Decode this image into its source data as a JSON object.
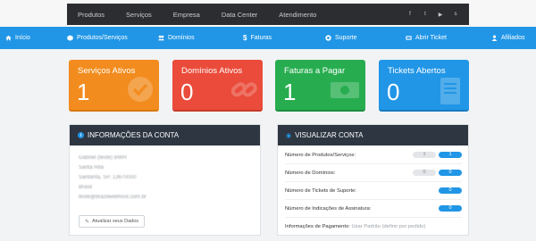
{
  "topnav": {
    "links": [
      "Produtos",
      "Serviços",
      "Empresa",
      "Data Center",
      "Atendimento"
    ],
    "socials": [
      "facebook-icon",
      "twitter-icon",
      "youtube-icon",
      "skype-icon"
    ]
  },
  "mainnav": {
    "items": [
      {
        "label": "Início",
        "icon": "home-icon"
      },
      {
        "label": "Produtos/Serviços",
        "icon": "cube-icon"
      },
      {
        "label": "Domínios",
        "icon": "users-icon"
      },
      {
        "label": "Faturas",
        "icon": "dollar-icon"
      },
      {
        "label": "Suporte",
        "icon": "support-icon"
      },
      {
        "label": "Abrir Ticket",
        "icon": "ticket-icon"
      },
      {
        "label": "Afiliados",
        "icon": "user-icon"
      }
    ]
  },
  "cards": [
    {
      "title": "Serviços Ativos",
      "count": "1",
      "color": "#f28c1e",
      "icon": "check-icon"
    },
    {
      "title": "Domínios Ativos",
      "count": "0",
      "color": "#ea4b3a",
      "icon": "link-icon"
    },
    {
      "title": "Faturas a Pagar",
      "count": "1",
      "color": "#27ad50",
      "icon": "money-icon"
    },
    {
      "title": "Tickets Abertos",
      "count": "0",
      "color": "#2196e6",
      "icon": "document-icon"
    }
  ],
  "account": {
    "heading": "INFORMAÇÕES DA CONTA",
    "lines": [
      "Gabriel (teste) BWH",
      "Santa Rita",
      "Santarita, SP, 13670000",
      "Brasil",
      "teste@brazilwebhost.com.br"
    ],
    "update_label": "Atualizar seus Dados"
  },
  "overview": {
    "heading": "VISUALIZAR CONTA",
    "rows": [
      {
        "label": "Número de Produtos/Serviços:",
        "grey": "1",
        "blue": "1"
      },
      {
        "label": "Número de Domínios:",
        "grey": "0",
        "blue": "0"
      },
      {
        "label": "Número de Tickets de Suporte:",
        "grey": "",
        "blue": "0"
      },
      {
        "label": "Número de Indicações de Assinatura:",
        "grey": "",
        "blue": "0"
      }
    ],
    "payment_label": "Informações de Pagamento:",
    "payment_value": "Usar Padrão (definir por pedido)"
  },
  "colors": {
    "topbar": "#2b2d30",
    "mainnav": "#2196e6",
    "panel_header": "#2d3641"
  }
}
